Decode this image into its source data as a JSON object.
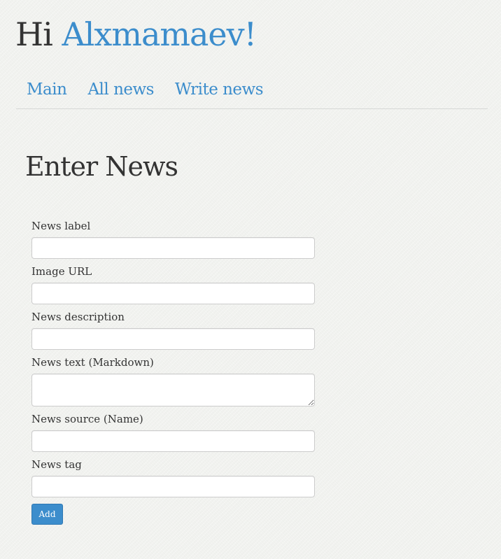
{
  "header": {
    "greeting_prefix": "Hi ",
    "username": "Alxmamaev!"
  },
  "nav": {
    "items": [
      {
        "label": "Main"
      },
      {
        "label": "All news"
      },
      {
        "label": "Write news"
      }
    ]
  },
  "main": {
    "title": "Enter News",
    "form": {
      "fields": [
        {
          "label": "News label",
          "value": ""
        },
        {
          "label": "Image URL",
          "value": ""
        },
        {
          "label": "News description",
          "value": ""
        },
        {
          "label": "News text (Markdown)",
          "value": ""
        },
        {
          "label": "News source (Name)",
          "value": ""
        },
        {
          "label": "News tag",
          "value": ""
        }
      ],
      "submit_label": "Add"
    }
  },
  "colors": {
    "accent": "#3c8dcc",
    "background": "#f1f2ef",
    "text": "#333333"
  }
}
